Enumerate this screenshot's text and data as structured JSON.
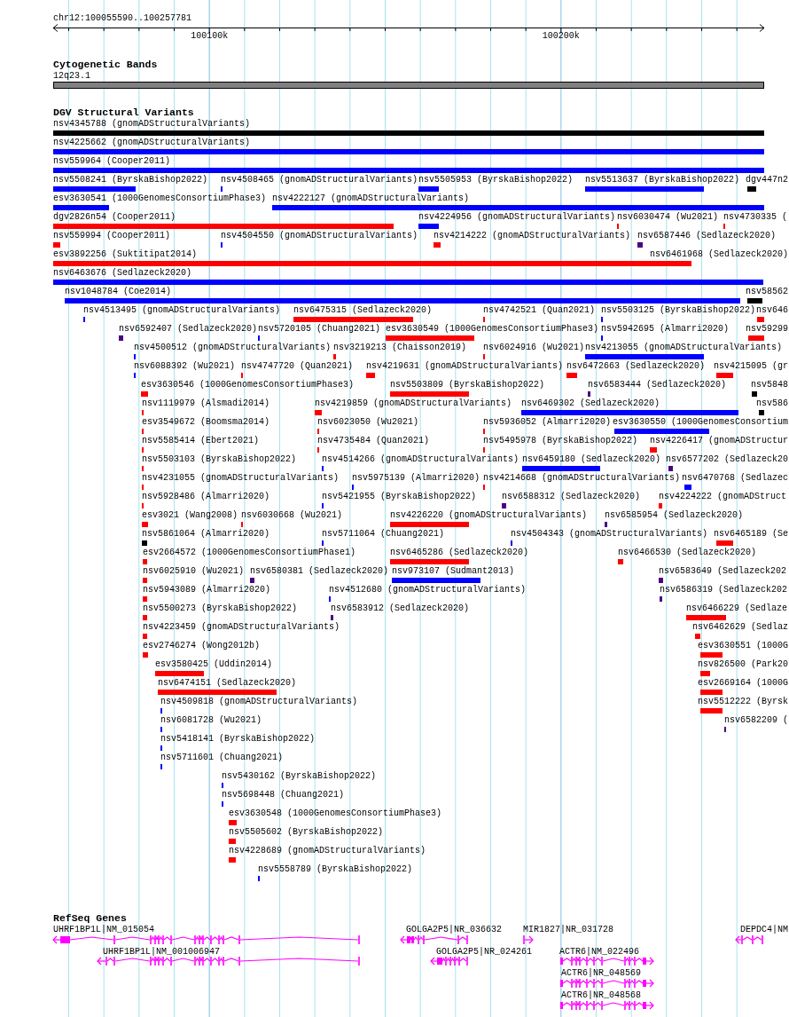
{
  "ruler": {
    "region": "chr12:100055590..100257781",
    "ticks": [
      {
        "label": "100100k"
      },
      {
        "label": "100200k"
      }
    ]
  },
  "cytoband_track": {
    "title": "Cytogenetic Bands",
    "band": {
      "label": "12q23.1"
    }
  },
  "variant_track": {
    "title": "DGV Structural Variants",
    "variants": [
      {
        "label": "nsv4345788 (gnomADStructuralVariants)",
        "color": "#000000"
      },
      {
        "label": "nsv4225662 (gnomADStructuralVariants)",
        "color": "#0000ff"
      },
      {
        "label": "nsv559964 (Cooper2011)",
        "color": "#0000ff"
      },
      {
        "label": "nsv5508241 (ByrskaBishop2022)",
        "color": "#0000ff"
      },
      {
        "label": "nsv4508465 (gnomADStructuralVariants)",
        "color": "#0000ff"
      },
      {
        "label": "nsv5505953 (ByrskaBishop2022)",
        "color": "#0000ff"
      },
      {
        "label": "nsv5513637 (ByrskaBishop2022)",
        "color": "#0000ff"
      },
      {
        "label": "dgv447n2",
        "color": "#000000"
      },
      {
        "label": "esv3630541 (1000GenomesConsortiumPhase3)",
        "color": "#0000ff"
      },
      {
        "label": "nsv4222127 (gnomADStructuralVariants)",
        "color": "#0000ff"
      },
      {
        "label": "dgv2826n54 (Cooper2011)",
        "color": "#ff0000"
      },
      {
        "label": "nsv4224956 (gnomADStructuralVariants)",
        "color": "#0000ff"
      },
      {
        "label": "nsv6030474 (Wu2021)",
        "color": "#ff0000"
      },
      {
        "label": "nsv4730335 (",
        "color": "#ff0000"
      },
      {
        "label": "nsv559994 (Cooper2011)",
        "color": "#ff0000"
      },
      {
        "label": "nsv4504550 (gnomADStructuralVariants)",
        "color": "#0000ff"
      },
      {
        "label": "nsv4214222 (gnomADStructuralVariants)",
        "color": "#ff0000"
      },
      {
        "label": "nsv6587446 (Sedlazeck2020)",
        "color": "#4b0082"
      },
      {
        "label": "esv3892256 (Suktitipat2014)",
        "color": "#ff0000"
      },
      {
        "label": "nsv6461968 (Sedlazeck2020)"
      },
      {
        "label": "nsv6463676 (Sedlazeck2020)",
        "color": "#0000ff"
      },
      {
        "label": "nsv1048784 (Coe2014)",
        "color": "#0000ff"
      },
      {
        "label": "nsv58562",
        "color": "#000000"
      },
      {
        "label": "nsv4513495 (gnomADStructuralVariants)",
        "color": "#0000ff"
      },
      {
        "label": "nsv6475315 (Sedlazeck2020)",
        "color": "#ff0000"
      },
      {
        "label": "nsv4742521 (Quan2021)",
        "color": "#ff0000"
      },
      {
        "label": "nsv5503125 (ByrskaBishop2022)",
        "color": "#0000ff"
      },
      {
        "label": "nsv646",
        "color": "#ff0000"
      },
      {
        "label": "nsv6592407 (Sedlazeck2020)",
        "color": "#4b0082"
      },
      {
        "label": "nsv5720105 (Chuang2021)",
        "color": "#0000ff"
      },
      {
        "label": "esv3630549 (1000GenomesConsortiumPhase3)",
        "color": "#ff0000"
      },
      {
        "label": "nsv5942695 (Almarri2020)",
        "color": "#0000ff"
      },
      {
        "label": "nsv59299",
        "color": "#ff0000"
      },
      {
        "label": "nsv4500512 (gnomADStructuralVariants)",
        "color": "#0000ff"
      },
      {
        "label": "nsv3219213 (Chaisson2019)",
        "color": "#ff0000"
      },
      {
        "label": "nsv6024916 (Wu2021)",
        "color": "#ff0000"
      },
      {
        "label": "nsv4213055 (gnomADStructuralVariants)",
        "color": "#0000ff"
      },
      {
        "label": "nsv6088392 (Wu2021)",
        "color": "#0000ff"
      },
      {
        "label": "nsv4747720 (Quan2021)",
        "color": "#ff0000"
      },
      {
        "label": "nsv4219631 (gnomADStructuralVariants)",
        "color": "#ff0000"
      },
      {
        "label": "nsv6472663 (Sedlazeck2020)",
        "color": "#ff0000"
      },
      {
        "label": "nsv4215095 (gr",
        "color": "#ff0000"
      },
      {
        "label": "esv3630546 (1000GenomesConsortiumPhase3)",
        "color": "#ff0000"
      },
      {
        "label": "nsv5503809 (ByrskaBishop2022)",
        "color": "#ff0000"
      },
      {
        "label": "nsv6583444 (Sedlazeck2020)",
        "color": "#4b0082"
      },
      {
        "label": "nsv5848",
        "color": "#000000"
      },
      {
        "label": "nsv1119979 (Alsmadi2014)",
        "color": "#ff0000"
      },
      {
        "label": "nsv4219859 (gnomADStructuralVariants)",
        "color": "#ff0000"
      },
      {
        "label": "nsv6469302 (Sedlazeck2020)",
        "color": "#0000ff"
      },
      {
        "label": "nsv586",
        "color": "#000000"
      },
      {
        "label": "esv3549672 (Boomsma2014)",
        "color": "#ff0000"
      },
      {
        "label": "nsv6023050 (Wu2021)",
        "color": "#ff0000"
      },
      {
        "label": "nsv5936052 (Almarri2020)",
        "color": "#ff0000"
      },
      {
        "label": "esv3630550 (1000GenomesConsortium",
        "color": "#0000ff"
      },
      {
        "label": "nsv5585414 (Ebert2021)",
        "color": "#ff0000"
      },
      {
        "label": "nsv4735484 (Quan2021)",
        "color": "#ff0000"
      },
      {
        "label": "nsv5495978 (ByrskaBishop2022)",
        "color": "#ff0000"
      },
      {
        "label": "nsv4226417 (gnomADStructur",
        "color": "#ff0000"
      },
      {
        "label": "nsv5503103 (ByrskaBishop2022)",
        "color": "#ff0000"
      },
      {
        "label": "nsv4514266 (gnomADStructuralVariants)",
        "color": "#0000ff"
      },
      {
        "label": "nsv6459180 (Sedlazeck2020)",
        "color": "#0000ff"
      },
      {
        "label": "nsv6577202 (Sedlazeck20",
        "color": "#4b0082"
      },
      {
        "label": "nsv4231055 (gnomADStructuralVariants)",
        "color": "#ff0000"
      },
      {
        "label": "nsv5975139 (Almarri2020)",
        "color": "#0000ff"
      },
      {
        "label": "nsv4214668 (gnomADStructuralVariants)",
        "color": "#ff0000"
      },
      {
        "label": "nsv6470768 (Sedlazec",
        "color": "#0000ff"
      },
      {
        "label": "nsv5928486 (Almarri2020)",
        "color": "#ff0000"
      },
      {
        "label": "nsv5421955 (ByrskaBishop2022)",
        "color": "#0000ff"
      },
      {
        "label": "nsv6588312 (Sedlazeck2020)",
        "color": "#4b0082"
      },
      {
        "label": "nsv4224222 (gnomADStruct",
        "color": "#ff0000"
      },
      {
        "label": "esv3021 (Wang2008)",
        "color": "#ff0000"
      },
      {
        "label": "nsv6030668 (Wu2021)",
        "color": "#ff0000"
      },
      {
        "label": "nsv4226220 (gnomADStructuralVariants)",
        "color": "#ff0000"
      },
      {
        "label": "nsv6585954 (Sedlazeck2020)",
        "color": "#4b0082"
      },
      {
        "label": "nsv5861064 (Almarri2020)",
        "color": "#000000"
      },
      {
        "label": "nsv5711064 (Chuang2021)",
        "color": "#0000ff"
      },
      {
        "label": "nsv4504343 (gnomADStructuralVariants)",
        "color": "#0000ff"
      },
      {
        "label": "nsv6465189 (Se",
        "color": "#ff0000"
      },
      {
        "label": "esv2664572 (1000GenomesConsortiumPhase1)",
        "color": "#ff0000"
      },
      {
        "label": "nsv6465286 (Sedlazeck2020)",
        "color": "#ff0000"
      },
      {
        "label": "nsv6466530 (Sedlazeck2020)",
        "color": "#ff0000"
      },
      {
        "label": "nsv6025910 (Wu2021)",
        "color": "#ff0000"
      },
      {
        "label": "nsv6580381 (Sedlazeck2020)",
        "color": "#4b0082"
      },
      {
        "label": "nsv973107 (Sudmant2013)",
        "color": "#0000ff"
      },
      {
        "label": "nsv6583649 (Sedlazeck202",
        "color": "#4b0082"
      },
      {
        "label": "nsv5943089 (Almarri2020)",
        "color": "#ff0000"
      },
      {
        "label": "nsv4512680 (gnomADStructuralVariants)",
        "color": "#0000ff"
      },
      {
        "label": "nsv6586319 (Sedlazeck202",
        "color": "#4b0082"
      },
      {
        "label": "nsv5500273 (ByrskaBishop2022)",
        "color": "#ff0000"
      },
      {
        "label": "nsv6583912 (Sedlazeck2020)",
        "color": "#4b0082"
      },
      {
        "label": "nsv6466229 (Sedlaze",
        "color": "#ff0000"
      },
      {
        "label": "nsv4223459 (gnomADStructuralVariants)",
        "color": "#ff0000"
      },
      {
        "label": "nsv6462629 (Sedlaz",
        "color": "#ff0000"
      },
      {
        "label": "esv2746274 (Wong2012b)",
        "color": "#ff0000"
      },
      {
        "label": "esv3630551 (1000G",
        "color": "#ff0000"
      },
      {
        "label": "esv3580425 (Uddin2014)",
        "color": "#ff0000"
      },
      {
        "label": "nsv826500 (Park20",
        "color": "#ff0000"
      },
      {
        "label": "nsv6474151 (Sedlazeck2020)",
        "color": "#ff0000"
      },
      {
        "label": "esv2669164 (1000G",
        "color": "#ff0000"
      },
      {
        "label": "nsv4509818 (gnomADStructuralVariants)",
        "color": "#0000ff"
      },
      {
        "label": "nsv5512222 (Byrsk",
        "color": "#ff0000"
      },
      {
        "label": "nsv6081728 (Wu2021)",
        "color": "#0000ff"
      },
      {
        "label": "nsv6582209 (",
        "color": "#4b0082"
      },
      {
        "label": "nsv5418141 (ByrskaBishop2022)",
        "color": "#0000ff"
      },
      {
        "label": "nsv5711601 (Chuang2021)",
        "color": "#0000ff"
      },
      {
        "label": "nsv5430162 (ByrskaBishop2022)",
        "color": "#0000ff"
      },
      {
        "label": "nsv5698448 (Chuang2021)",
        "color": "#0000ff"
      },
      {
        "label": "esv3630548 (1000GenomesConsortiumPhase3)",
        "color": "#ff0000"
      },
      {
        "label": "nsv5505602 (ByrskaBishop2022)",
        "color": "#ff0000"
      },
      {
        "label": "nsv4228689 (gnomADStructuralVariants)",
        "color": "#ff0000"
      },
      {
        "label": "nsv5558789 (ByrskaBishop2022)",
        "color": "#0000ff"
      }
    ]
  },
  "gene_track": {
    "title": "RefSeq Genes",
    "genes": [
      {
        "label": "UHRF1BP1L|NM_015054",
        "reverse_strand": true
      },
      {
        "label": "GOLGA2P5|NR_036632",
        "reverse_strand": true
      },
      {
        "label": "MIR1827|NR_031728",
        "reverse_strand": false
      },
      {
        "label": "DEPDC4|NM",
        "reverse_strand": true
      },
      {
        "label": "UHRF1BP1L|NM_001006947",
        "reverse_strand": true
      },
      {
        "label": "GOLGA2P5|NR_024261",
        "reverse_strand": true
      },
      {
        "label": "ACTR6|NM_022496",
        "reverse_strand": false
      },
      {
        "label": "ACTR6|NR_048569",
        "reverse_strand": false
      },
      {
        "label": "ACTR6|NR_048568",
        "reverse_strand": false
      }
    ]
  }
}
